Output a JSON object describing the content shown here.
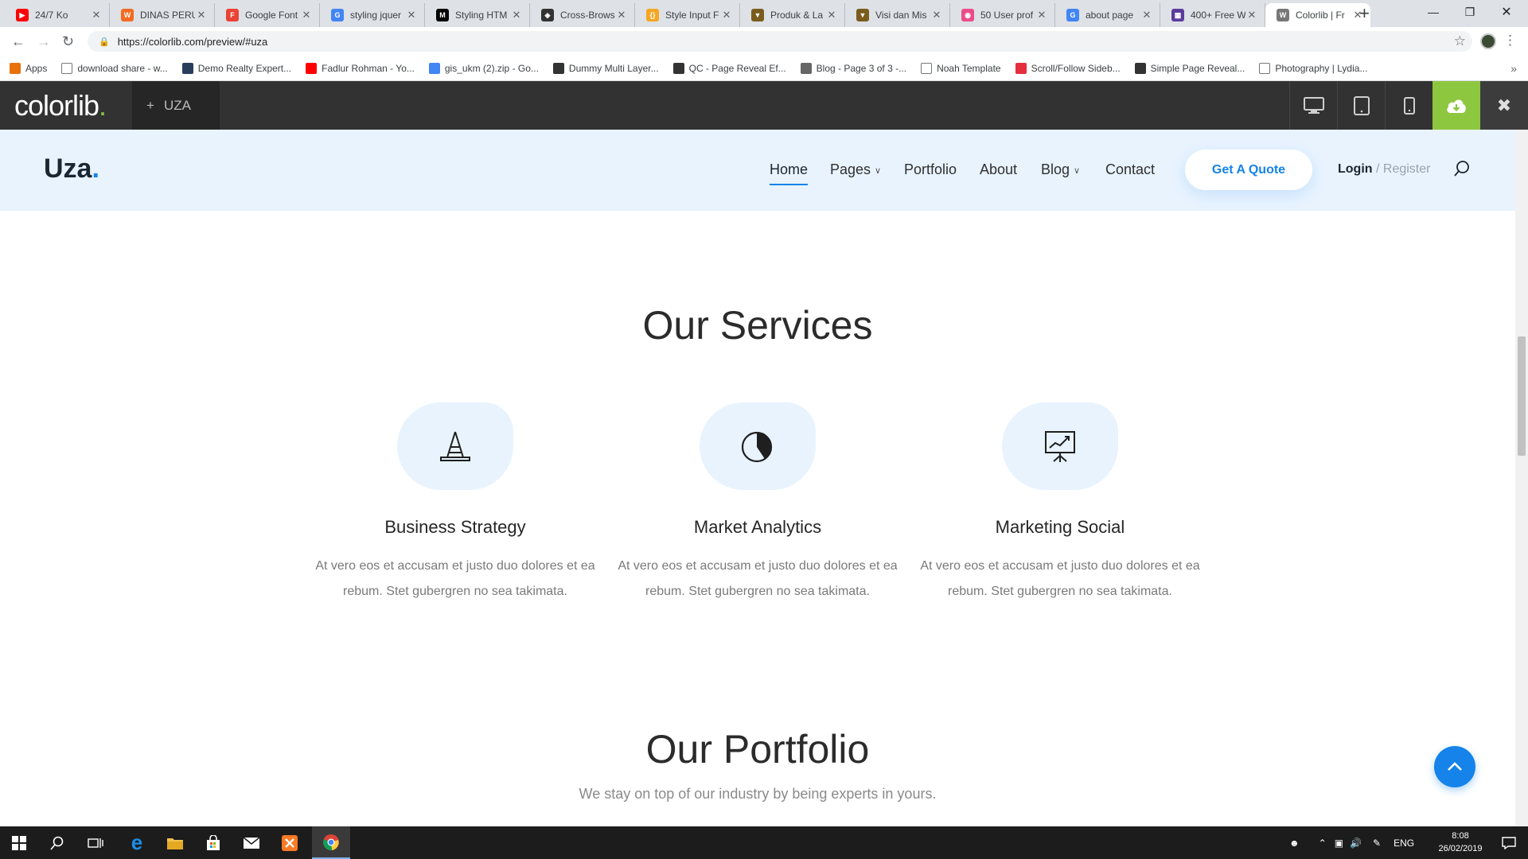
{
  "browser": {
    "tabs": [
      {
        "title": "24/7 Ko",
        "color": "#ff0000",
        "glyph": "▶"
      },
      {
        "title": "DINAS PERU",
        "color": "#f26b21",
        "glyph": "W"
      },
      {
        "title": "Google Font",
        "color": "#ea4335",
        "glyph": "F"
      },
      {
        "title": "styling jquer",
        "color": "#4285f4",
        "glyph": "G"
      },
      {
        "title": "Styling HTM",
        "color": "#000000",
        "glyph": "M"
      },
      {
        "title": "Cross-Brows",
        "color": "#333333",
        "glyph": "◈"
      },
      {
        "title": "Style Input F",
        "color": "#f5a623",
        "glyph": "{}"
      },
      {
        "title": "Produk & La",
        "color": "#7a5c1e",
        "glyph": "▼"
      },
      {
        "title": "Visi dan Mis",
        "color": "#7a5c1e",
        "glyph": "▼"
      },
      {
        "title": "50 User prof",
        "color": "#ea4c89",
        "glyph": "◉"
      },
      {
        "title": "about page",
        "color": "#4285f4",
        "glyph": "G"
      },
      {
        "title": "400+ Free W",
        "color": "#5b3c9c",
        "glyph": "▦"
      },
      {
        "title": "Colorlib | Fr",
        "color": "#777777",
        "glyph": "W"
      }
    ],
    "url": "https://colorlib.com/preview/#uza",
    "bookmarks": [
      {
        "label": "Apps",
        "color": "#e8710a"
      },
      {
        "label": "download share - w...",
        "color": "#ffffff"
      },
      {
        "label": "Demo Realty Expert...",
        "color": "#2a3e5c"
      },
      {
        "label": "Fadlur Rohman - Yo...",
        "color": "#ff0000"
      },
      {
        "label": "gis_ukm (2).zip - Go...",
        "color": "#4285f4"
      },
      {
        "label": "Dummy Multi Layer...",
        "color": "#333333"
      },
      {
        "label": "QC - Page Reveal Ef...",
        "color": "#333333"
      },
      {
        "label": "Blog - Page 3 of 3 -...",
        "color": "#666666"
      },
      {
        "label": "Noah Template",
        "color": "#ffffff"
      },
      {
        "label": "Scroll/Follow Sideb...",
        "color": "#e52f3e"
      },
      {
        "label": "Simple Page Reveal...",
        "color": "#333333"
      },
      {
        "label": "Photography | Lydia...",
        "color": "#ffffff"
      }
    ]
  },
  "preview": {
    "brand": "colorlib",
    "brand_dot": ".",
    "theme_name": "UZA",
    "accent": "#8dc63f"
  },
  "site": {
    "logo": "Uza",
    "logo_dot": ".",
    "nav": [
      "Home",
      "Pages",
      "Portfolio",
      "About",
      "Blog",
      "Contact"
    ],
    "quote_button": "Get A Quote",
    "login": "Login",
    "register": "/ Register",
    "accent": "#1583e9",
    "services_title": "Our Services",
    "services": [
      {
        "name": "Business Strategy",
        "icon": "strategy-cone-icon",
        "desc_1": "At vero eos et accusam et justo duo dolores et ea",
        "desc_2": "rebum. Stet gubergren no sea takimata."
      },
      {
        "name": "Market Analytics",
        "icon": "pie-chart-icon",
        "desc_1": "At vero eos et accusam et justo duo dolores et ea",
        "desc_2": "rebum. Stet gubergren no sea takimata."
      },
      {
        "name": "Marketing Social",
        "icon": "presentation-board-icon",
        "desc_1": "At vero eos et accusam et justo duo dolores et ea",
        "desc_2": "rebum. Stet gubergren no sea takimata."
      }
    ],
    "portfolio_title": "Our Portfolio",
    "portfolio_subtitle": "We stay on top of our industry by being experts in yours."
  },
  "taskbar": {
    "language": "ENG",
    "time": "8:08",
    "date": "26/02/2019"
  }
}
